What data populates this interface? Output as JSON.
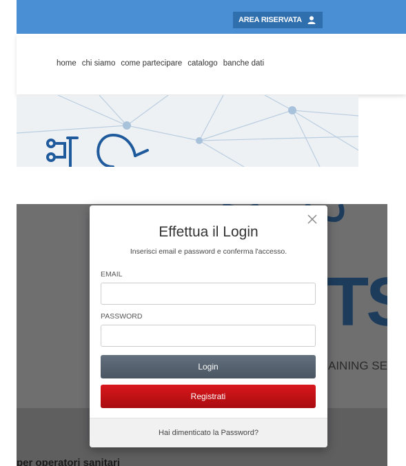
{
  "header": {
    "area_button_label": "AREA RISERVATA",
    "area_button_icon": "user-icon"
  },
  "nav": {
    "items": [
      "home",
      "chi siamo",
      "come partecipare",
      "catalogo",
      "banche dati"
    ]
  },
  "background": {
    "brand_fragment": "TS",
    "tagline_fragment": "AINING SE",
    "bottom_text": "per operatori sanitari"
  },
  "modal": {
    "title": "Effettua il Login",
    "subtitle": "Inserisci email e password e conferma l'accesso.",
    "email_label": "EMAIL",
    "email_value": "",
    "password_label": "PASSWORD",
    "password_value": "",
    "login_button": "Login",
    "register_button": "Registrati",
    "forgot_link": "Hai dimenticato la Password?",
    "close_icon": "close-icon"
  },
  "colors": {
    "topbar": "#4a8fd4",
    "area_button": "#2f6fae",
    "login_button": "#56626e",
    "register_button": "#c41117",
    "brand_navy": "#1d3c5c"
  }
}
